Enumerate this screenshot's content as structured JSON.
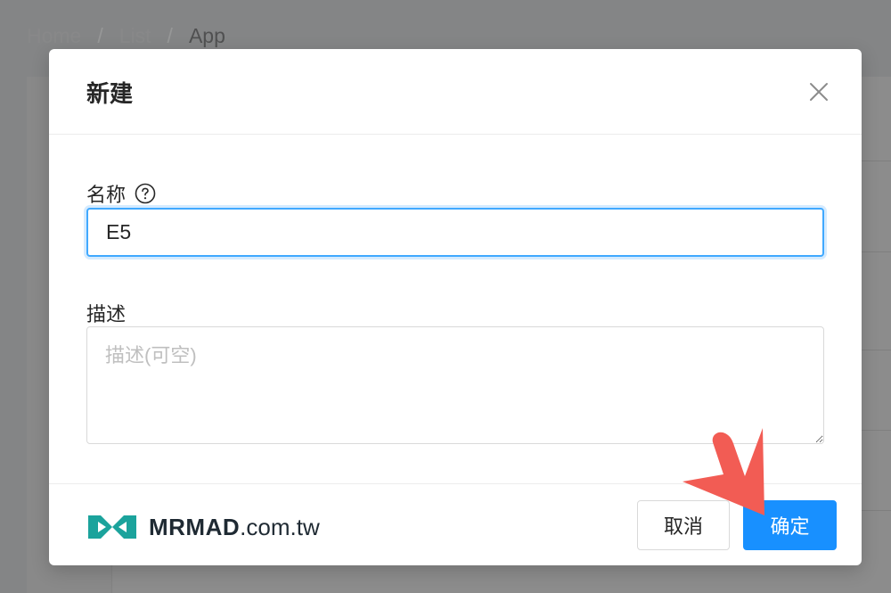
{
  "breadcrumb": {
    "items": [
      "Home",
      "List"
    ],
    "current": "App",
    "separator": "/"
  },
  "modal": {
    "title": "新建",
    "close_icon": "close-icon"
  },
  "form": {
    "name_label": "名称",
    "name_help_icon": "question-circle-icon",
    "name_value": "E5",
    "desc_label": "描述",
    "desc_placeholder": "描述(可空)",
    "desc_value": ""
  },
  "footer": {
    "brand_strong": "MRMAD",
    "brand_rest": ".com.tw",
    "brand_icon": "mrmad-logo-icon",
    "cancel_label": "取消",
    "ok_label": "确定"
  },
  "colors": {
    "primary": "#1890ff",
    "focus_border": "#40a9ff",
    "arrow": "#f25c54",
    "logo": "#1ba39c",
    "overlay": "rgba(0,0,0,0.45)"
  }
}
